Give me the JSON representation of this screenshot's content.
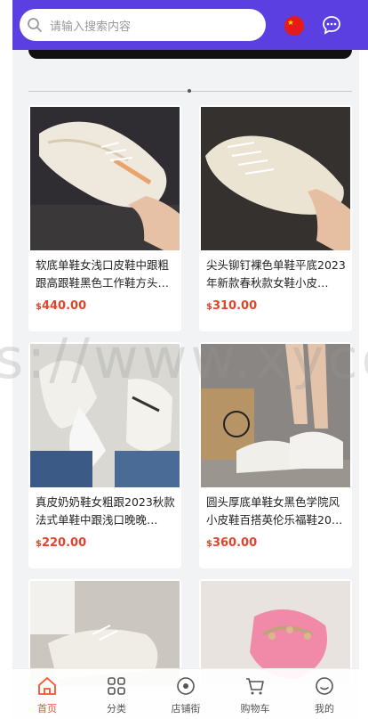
{
  "search": {
    "placeholder": "请输入搜索内容"
  },
  "watermark": "s://www.xycoo",
  "products": [
    {
      "name": "软底单鞋女浅口皮鞋中跟粗跟高跟鞋黑色工作鞋方头…",
      "currency": "$",
      "price": "440.00"
    },
    {
      "name": "尖头铆钉裸色单鞋平底2023年新款春秋款女鞋小皮…",
      "currency": "$",
      "price": "310.00"
    },
    {
      "name": "真皮奶奶鞋女粗跟2023秋款法式单鞋中跟浅口晚晚…",
      "currency": "$",
      "price": "220.00"
    },
    {
      "name": "圆头厚底单鞋女黑色学院风小皮鞋百搭英伦乐福鞋20…",
      "currency": "$",
      "price": "360.00"
    }
  ],
  "tabs": [
    {
      "label": "首页",
      "icon": "home-icon",
      "active": true
    },
    {
      "label": "分类",
      "icon": "category-grid-icon"
    },
    {
      "label": "店铺街",
      "icon": "store-street-icon"
    },
    {
      "label": "购物车",
      "icon": "cart-icon"
    },
    {
      "label": "我的",
      "icon": "profile-icon"
    }
  ],
  "colors": {
    "header": "#5b3fe0",
    "price": "#e1442b",
    "active_tab": "#f2542d"
  }
}
